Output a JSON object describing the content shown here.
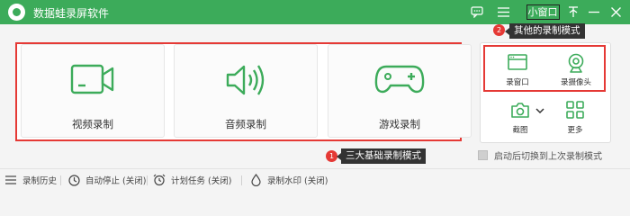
{
  "app": {
    "title": "数据蛙录屏软件",
    "brand_color": "#3cab5a"
  },
  "titlebar": {
    "feedback_icon": "chat-bubble-icon",
    "menu_icon": "hamburger-menu-icon",
    "mini_window_label": "小窗口",
    "pin_icon": "pin-icon",
    "minimize_icon": "minimize-icon",
    "close_icon": "close-icon"
  },
  "modes": [
    {
      "label": "视频录制",
      "icon": "video-camera-icon"
    },
    {
      "label": "音频录制",
      "icon": "speaker-icon"
    },
    {
      "label": "游戏录制",
      "icon": "gamepad-icon"
    }
  ],
  "side": {
    "window_label": "录窗口",
    "camera_label": "录摄像头",
    "screenshot_label": "截图",
    "more_label": "更多"
  },
  "annotations": {
    "badge1": "1",
    "callout1": "三大基础录制模式",
    "badge2": "2",
    "callout2": "其他的录制模式",
    "accent_color": "#e53935"
  },
  "auto_switch_label": "启动后切换到上次录制模式",
  "footer": {
    "history": "录制历史",
    "autostop": "自动停止 (关闭)",
    "schedule": "计划任务 (关闭)",
    "watermark": "录制水印 (关闭)"
  }
}
